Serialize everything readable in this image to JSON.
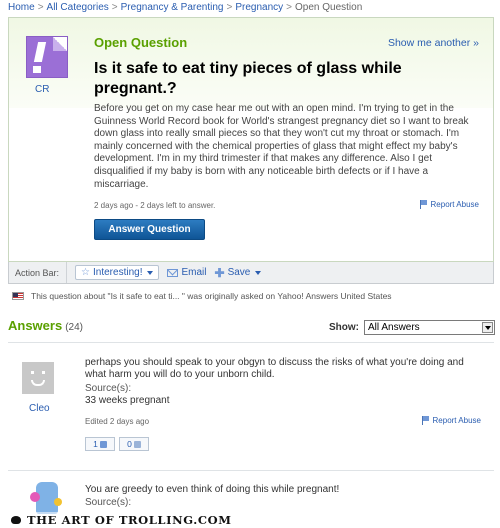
{
  "breadcrumb": [
    {
      "label": "Home",
      "link": true
    },
    {
      "label": "All Categories",
      "link": true
    },
    {
      "label": "Pregnancy & Parenting",
      "link": true
    },
    {
      "label": "Pregnancy",
      "link": true
    },
    {
      "label": "Open Question",
      "link": false
    }
  ],
  "breadcrumb_sep": ">",
  "question": {
    "status": "Open Question",
    "show_more": "Show me another »",
    "user": "CR",
    "title": "Is it safe to eat tiny pieces of glass while pregnant.?",
    "body": "Before you get on my case hear me out with an open mind. I'm trying to get in the Guinness World Record book for World's strangest pregnancy diet so I want to break down glass into really small pieces so that they won't cut my throat or stomach. I'm mainly concerned with the chemical properties of glass that might effect my baby's development. I'm in my third trimester if that makes any difference. Also I get disqualified if my baby is born with any noticeable birth defects or if I have a miscarriage.",
    "meta": "2 days ago - 2 days left to answer.",
    "report": "Report Abuse",
    "answer_button": "Answer Question"
  },
  "action_bar": {
    "label": "Action Bar:",
    "interesting": "Interesting!",
    "email": "Email",
    "save": "Save"
  },
  "origin_note": "This question about \"Is it safe to eat ti... \" was originally asked on Yahoo! Answers United States",
  "answers": {
    "heading": "Answers",
    "count": "(24)",
    "show_label": "Show:",
    "show_value": "All Answers",
    "items": [
      {
        "user": "Cleo",
        "text": "perhaps you should speak to your obgyn to discuss the risks of what you're doing and what harm you will do to your unborn child.",
        "source_label": "Source(s):",
        "source": "33 weeks pregnant",
        "meta": "Edited 2 days ago",
        "report": "Report Abuse",
        "thumbs_up": "1",
        "thumbs_down": "0"
      },
      {
        "text": "You are greedy to even think of doing this while pregnant!",
        "source_label": "Source(s):"
      }
    ]
  },
  "watermark": "THE ART OF TROLLING.COM",
  "colors": {
    "accent_green": "#5aa000",
    "link_blue": "#2a5db0",
    "avatar_purple": "#9b6fd6",
    "button_blue": "#1a65a8"
  },
  "icons": [
    "flag-icon",
    "star-icon",
    "mail-icon",
    "plus-icon",
    "thumbs-up-icon",
    "thumbs-down-icon",
    "us-flag-icon"
  ]
}
